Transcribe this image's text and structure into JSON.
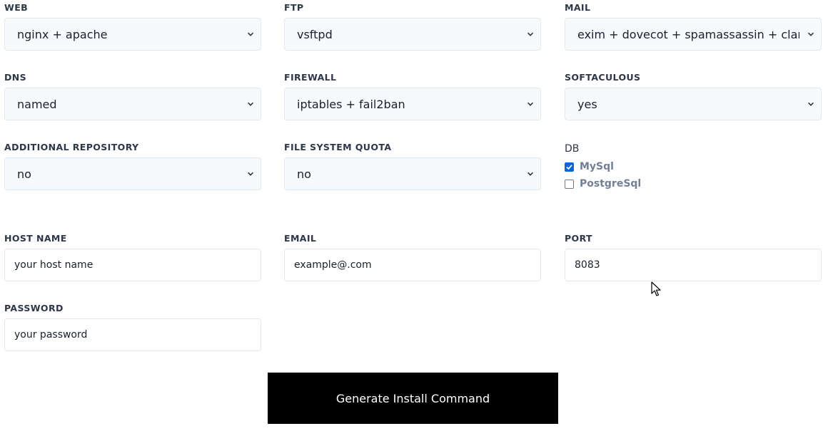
{
  "fields": {
    "web": {
      "label": "WEB",
      "value": "nginx + apache"
    },
    "ftp": {
      "label": "FTP",
      "value": "vsftpd"
    },
    "mail": {
      "label": "MAIL",
      "value": "exim + dovecot + spamassassin + clamav"
    },
    "dns": {
      "label": "DNS",
      "value": "named"
    },
    "firewall": {
      "label": "FIREWALL",
      "value": "iptables + fail2ban"
    },
    "softaculous": {
      "label": "SOFTACULOUS",
      "value": "yes"
    },
    "additional_repository": {
      "label": "ADDITIONAL REPOSITORY",
      "value": "no"
    },
    "file_system_quota": {
      "label": "FILE SYSTEM QUOTA",
      "value": "no"
    }
  },
  "db": {
    "title": "DB",
    "options": [
      {
        "label": "MySql",
        "checked": true
      },
      {
        "label": "PostgreSql",
        "checked": false
      }
    ]
  },
  "inputs": {
    "host_name": {
      "label": "HOST NAME",
      "value": "your host name"
    },
    "email": {
      "label": "EMAIL",
      "value": "example@.com"
    },
    "port": {
      "label": "PORT",
      "value": "8083"
    },
    "password": {
      "label": "PASSWORD",
      "value": "your password"
    }
  },
  "actions": {
    "generate_label": "Generate Install Command"
  },
  "colors": {
    "button_bg": "#000000",
    "button_text": "#ffffff",
    "checkbox_checked": "#0a66d6"
  },
  "icons": {
    "select_chevron": "chevron-down-icon",
    "mouse_cursor": "mouse-pointer-icon"
  }
}
